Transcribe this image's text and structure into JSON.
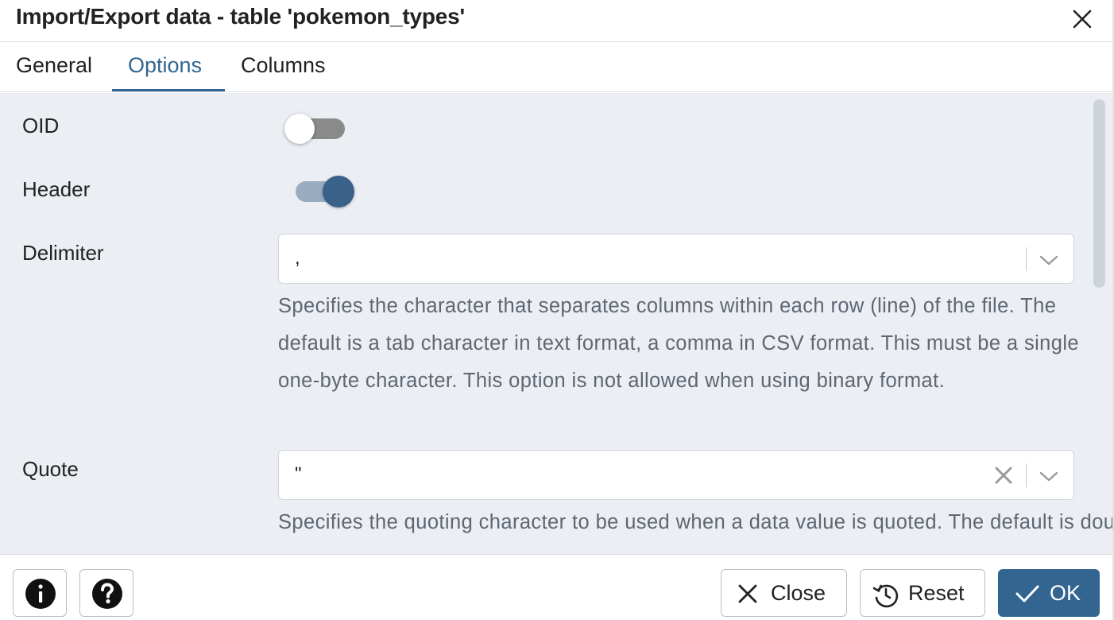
{
  "dialog": {
    "title": "Import/Export data - table 'pokemon_types'"
  },
  "tabs": [
    {
      "label": "General",
      "active": false
    },
    {
      "label": "Options",
      "active": true
    },
    {
      "label": "Columns",
      "active": false
    }
  ],
  "options": {
    "oid": {
      "label": "OID",
      "checked": false
    },
    "header": {
      "label": "Header",
      "checked": true
    },
    "delimiter": {
      "label": "Delimiter",
      "value": ",",
      "help": "Specifies the character that separates columns within each row (line) of the file. The default is a tab character in text format, a comma in CSV format. This must be a single one-byte character. This option is not allowed when using binary format."
    },
    "quote": {
      "label": "Quote",
      "value": "\"",
      "help": "Specifies the quoting character to be used when a data value is quoted. The default is double-quote. This must be a single one-byte character. This option is allowed only when using CSV format."
    }
  },
  "footer": {
    "close_label": "Close",
    "reset_label": "Reset",
    "ok_label": "OK"
  },
  "icons": {
    "close": "close-icon",
    "info": "info-icon",
    "help": "question-icon",
    "reset": "reset-icon",
    "ok": "check-icon",
    "dropdown": "chevron-down-icon",
    "clear": "clear-icon"
  },
  "colors": {
    "accent": "#326690",
    "content_bg": "#ebeef3",
    "help_text": "#5f6672",
    "toggle_on_knob": "#3a6189",
    "toggle_on_track": "#9aacc2",
    "toggle_off_track": "#8a8a8a"
  }
}
